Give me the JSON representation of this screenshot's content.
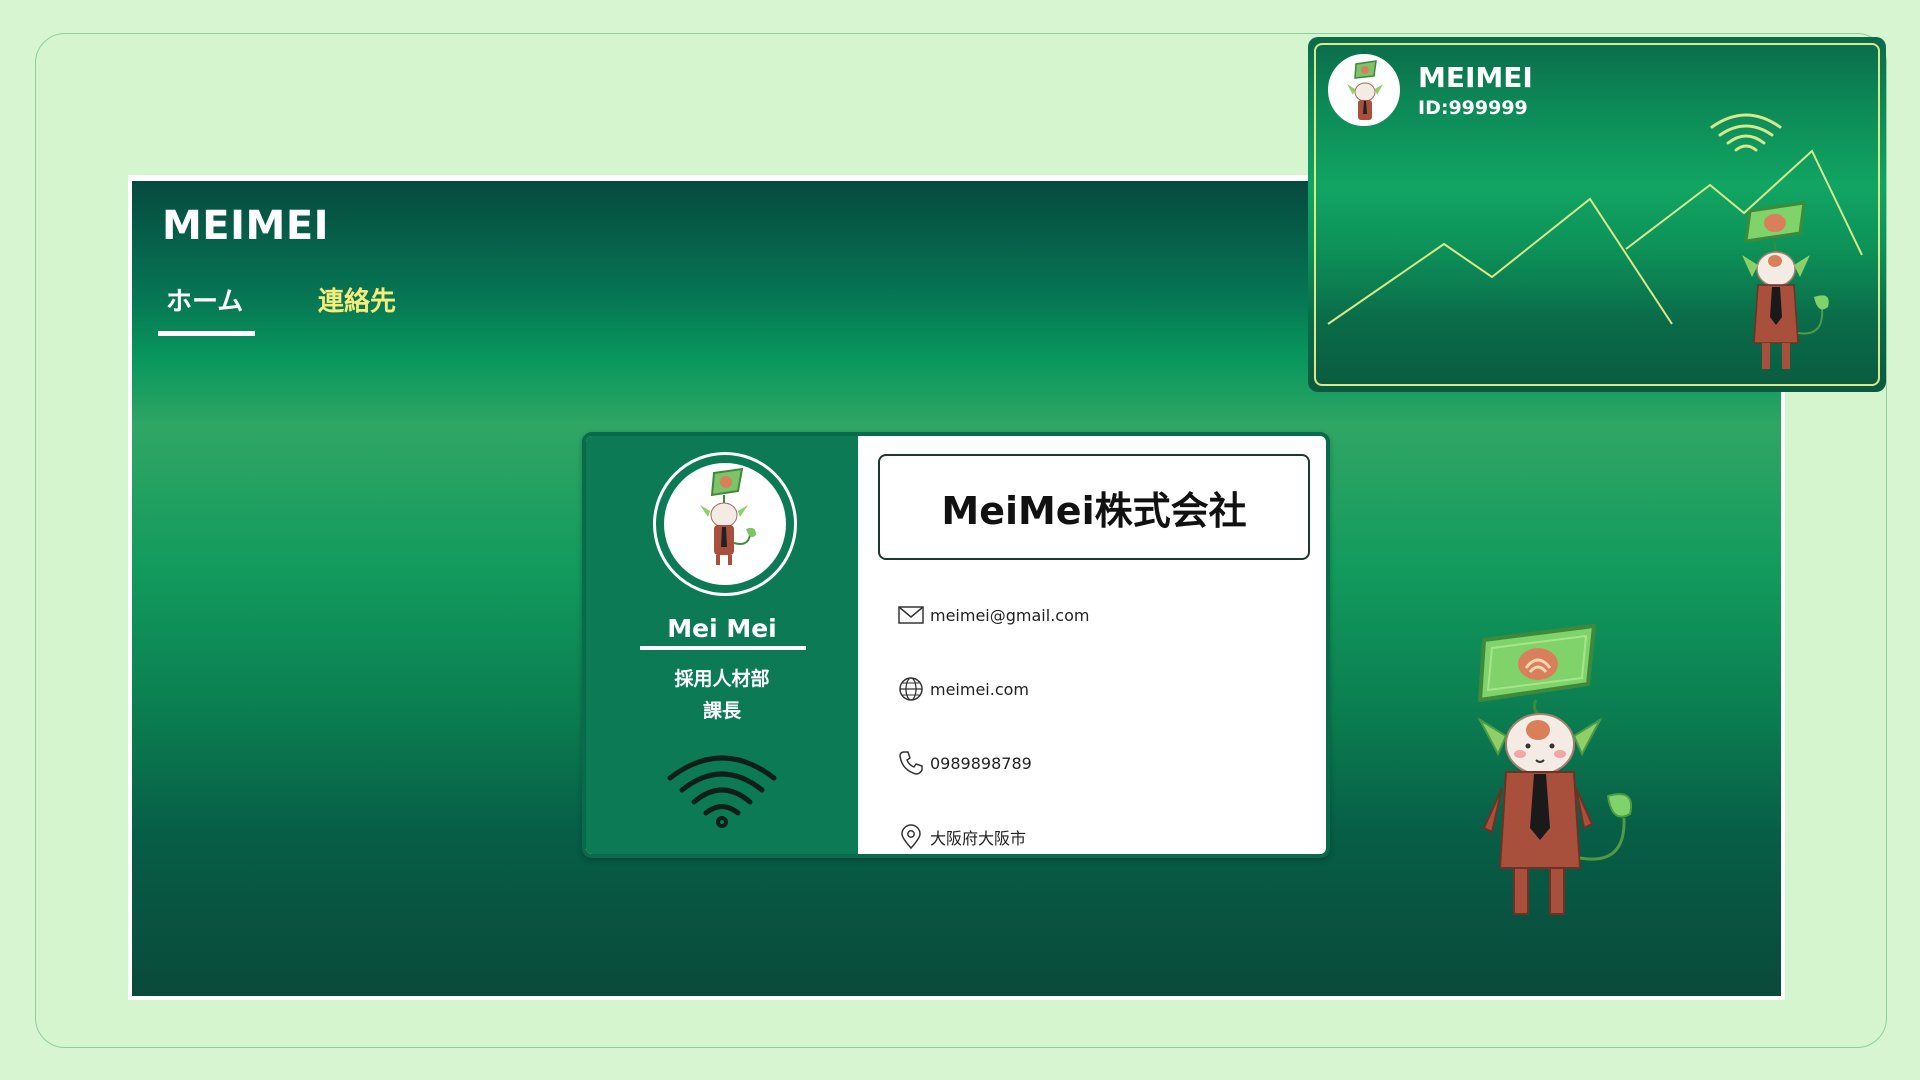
{
  "app": {
    "brand": "MEIMEI",
    "tabs": [
      {
        "label": "ホーム",
        "active": true
      },
      {
        "label": "連絡先",
        "active": false
      }
    ]
  },
  "card": {
    "name": "Mei Mei",
    "role_line1": "採用人材部",
    "role_line2": "課長",
    "company": "MeiMei株式会社",
    "contacts": [
      {
        "icon": "mail-icon",
        "text": "meimei@gmail.com"
      },
      {
        "icon": "globe-icon",
        "text": "meimei.com"
      },
      {
        "icon": "phone-icon",
        "text": "0989898789"
      },
      {
        "icon": "location-pin-icon",
        "text": "大阪府大阪市"
      }
    ]
  },
  "idcard": {
    "name": "MEIMEI",
    "id": "ID:999999"
  },
  "colors": {
    "background": "#d7f5d0",
    "card_green": "#0b7a55",
    "tab_inactive": "#f7ec7a",
    "id_border": "#d8e88a"
  }
}
